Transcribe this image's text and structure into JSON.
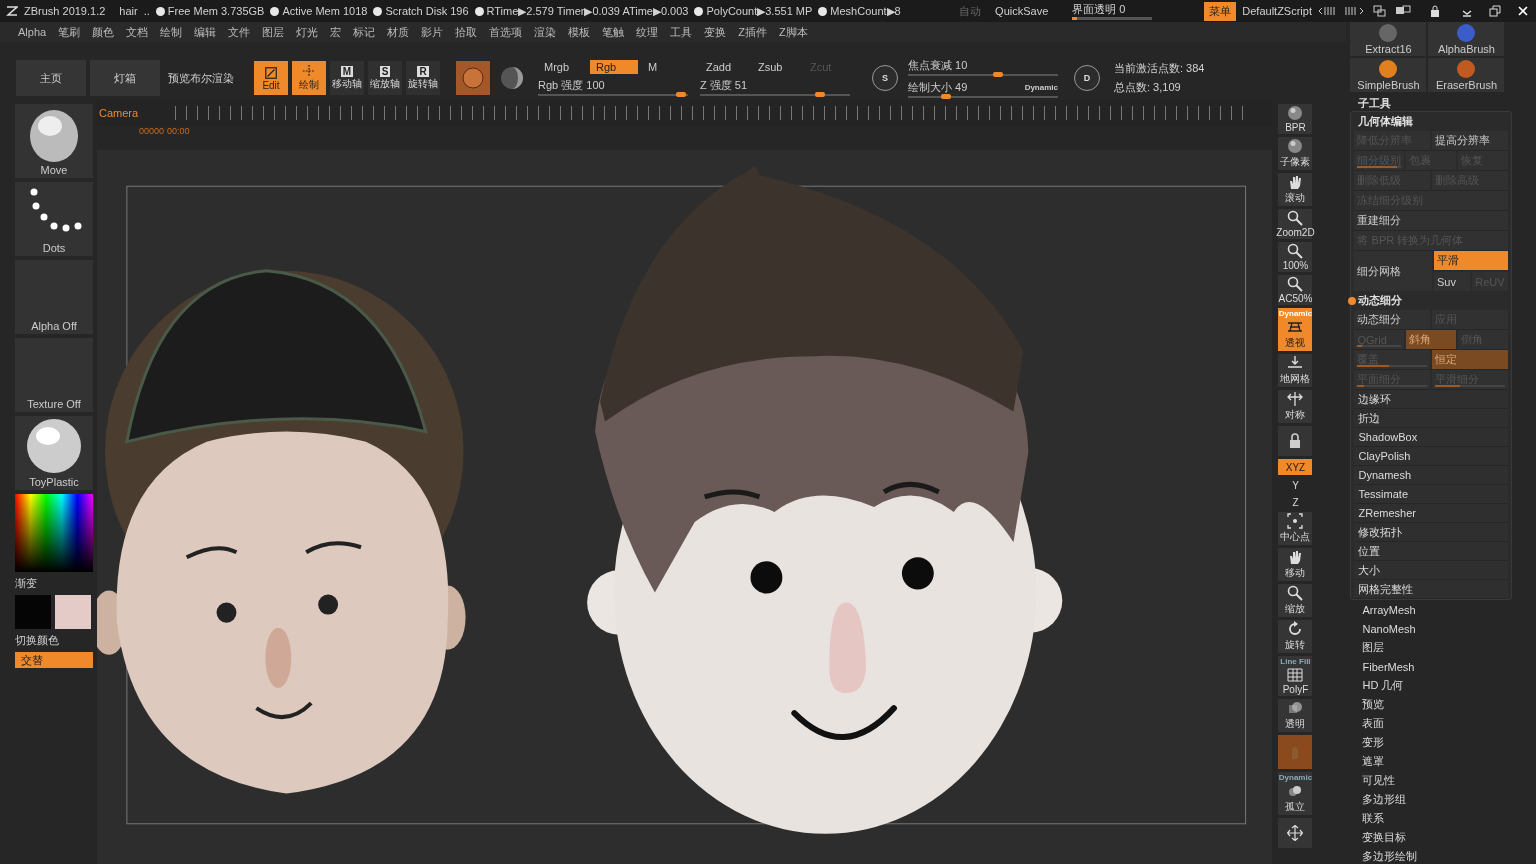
{
  "title_bar": {
    "app": "ZBrush 2019.1.2",
    "document": "hair",
    "more": "..",
    "stats": [
      "Free Mem 3.735GB",
      "Active Mem 1018",
      "Scratch Disk 196",
      "RTime▶2.579 Timer▶0.039 ATime▶0.003",
      "PolyCount▶3.551 MP",
      "MeshCount▶8"
    ],
    "auto": {
      "label": "自动",
      "disabled": true
    },
    "quicksave": "QuickSave",
    "transparency": {
      "label": "界面透明 0",
      "level": 0.06
    },
    "menu_button": "菜单",
    "script": "DefaultZScript"
  },
  "menus": [
    "Alpha",
    "笔刷",
    "颜色",
    "文档",
    "绘制",
    "编辑",
    "文件",
    "图层",
    "灯光",
    "宏",
    "标记",
    "材质",
    "影片",
    "拾取",
    "首选项",
    "渲染",
    "模板",
    "笔触",
    "纹理",
    "工具",
    "变换",
    "Z插件",
    "Z脚本"
  ],
  "toolbar": {
    "buttons": [
      "主页",
      "灯箱"
    ],
    "preview": "预览布尔渲染",
    "modes": [
      {
        "kind": "edit",
        "label": "Edit",
        "selected": true
      },
      {
        "kind": "draw",
        "label": "绘制",
        "selected": true
      },
      {
        "kind": "axis",
        "key": "M",
        "label": "移动轴",
        "selected": false
      },
      {
        "kind": "axis",
        "key": "S",
        "label": "缩放轴",
        "selected": false
      },
      {
        "kind": "axis",
        "key": "R",
        "label": "旋转轴",
        "selected": false
      }
    ],
    "channels": [
      {
        "label": "Mrgb",
        "selected": false
      },
      {
        "label": "Rgb",
        "selected": true
      },
      {
        "label": "M",
        "selected": false
      }
    ],
    "rgb_intensity": {
      "label": "Rgb 强度 100",
      "level": 0.95
    },
    "depth_modes": [
      {
        "label": "Zadd",
        "disabled": false
      },
      {
        "label": "Zsub",
        "disabled": false
      },
      {
        "label": "Zcut",
        "disabled": true
      }
    ],
    "z_intensity": {
      "label": "Z 强度 51",
      "level": 0.8
    },
    "s_key": "S",
    "focal_shift": {
      "label": "焦点衰减 10",
      "level": 0.6
    },
    "draw_size": {
      "label": "绘制大小 49",
      "level": 0.25
    },
    "dynamic": "Dynamic",
    "d_key": "D",
    "active_points": "当前激活点数: 384",
    "total_points": "总点数: 3,109"
  },
  "shelf": {
    "thumbs": [
      {
        "kind": "brush",
        "label": "Move"
      },
      {
        "kind": "stroke",
        "label": "Dots"
      },
      {
        "kind": "empty",
        "label": "Alpha Off"
      },
      {
        "kind": "empty",
        "label": "Texture Off"
      },
      {
        "kind": "material",
        "label": "ToyPlastic"
      }
    ],
    "gradient": "渐变",
    "swatches": [
      {
        "color": "#050505"
      },
      {
        "color": "#e4cbc8"
      }
    ],
    "switch_color": "切换颜色",
    "alternate": "交替"
  },
  "timeline": {
    "label": "Camera",
    "frame": "00000",
    "time": "00:00"
  },
  "right_shelf": [
    {
      "kind": "sphere",
      "label": "BPR"
    },
    {
      "kind": "subpixel",
      "label": "子像素"
    },
    {
      "kind": "hand",
      "label": "滚动"
    },
    {
      "kind": "zoom",
      "label": "Zoom2D"
    },
    {
      "kind": "zoom",
      "label": "100%"
    },
    {
      "kind": "zoom",
      "label": "AC50%"
    },
    {
      "kind": "perspective",
      "top": "Dynamic",
      "label": "透视",
      "selected": true
    },
    {
      "kind": "floor",
      "label": "地网格"
    },
    {
      "kind": "symmetry",
      "label": "对称"
    },
    {
      "kind": "lock"
    },
    {
      "kind": "xyz",
      "label": "XYZ",
      "selected": true
    },
    {
      "kind": "small",
      "label": "Y"
    },
    {
      "kind": "small",
      "label": "Z"
    },
    {
      "kind": "center",
      "label": "中心点"
    },
    {
      "kind": "hand",
      "label": "移动"
    },
    {
      "kind": "zoom",
      "label": "缩放"
    },
    {
      "kind": "rotate",
      "label": "旋转"
    },
    {
      "kind": "polyframe",
      "top": "Line Fill",
      "label": "PolyF"
    },
    {
      "kind": "transp",
      "label": "透明"
    },
    {
      "kind": "ghost"
    },
    {
      "kind": "solo",
      "top": "Dynamic",
      "label": "孤立"
    },
    {
      "kind": "expand"
    }
  ],
  "right_panel": {
    "brushes": [
      {
        "kind": "extract",
        "label": "Extract16"
      },
      {
        "kind": "alpha",
        "label": "AlphaBrush"
      },
      {
        "kind": "simple",
        "label": "SimpleBrush"
      },
      {
        "kind": "eraser",
        "label": "EraserBrush"
      }
    ],
    "subtool": "子工具",
    "geometry": {
      "title": "几何体编辑",
      "rows": [
        [
          {
            "label": "降低分辨率",
            "disabled": true
          },
          {
            "label": "提高分辨率",
            "disabled": false
          }
        ],
        [
          {
            "label": "细分级别",
            "disabled": true,
            "level": 0.9
          },
          {
            "label": "包裹",
            "disabled": true
          },
          {
            "label": "恢复",
            "disabled": true
          }
        ],
        [
          {
            "label": "删除低级",
            "disabled": true
          },
          {
            "label": "删除高级",
            "disabled": true
          }
        ],
        [
          {
            "label": "冻结细分级别",
            "disabled": true
          }
        ],
        [
          {
            "label": "重建细分",
            "disabled": false
          }
        ],
        [
          {
            "label": "将 BPR 转换为几何体",
            "disabled": true
          }
        ]
      ],
      "divide": {
        "label": "细分网格",
        "smooth": {
          "label": "平滑",
          "selected": true
        },
        "options": [
          {
            "label": "Suv",
            "selected": false,
            "disabled": false
          },
          {
            "label": "ReUV",
            "selected": false,
            "disabled": true
          }
        ]
      },
      "dynamic_title": "动态细分",
      "dynamic_rows": [
        [
          {
            "label": "动态细分",
            "disabled": false
          },
          {
            "label": "应用",
            "disabled": true
          }
        ],
        [
          {
            "label": "QGrid",
            "disabled": true,
            "level": 0.1
          },
          {
            "label": "斜角",
            "disabled": true,
            "selected": true
          },
          {
            "label": "倒角",
            "disabled": true,
            "selected": false
          }
        ],
        [
          {
            "label": "覆盖",
            "disabled": true,
            "level": 0.45
          },
          {
            "label": "恒定",
            "disabled": true,
            "selected": true
          }
        ],
        [
          {
            "label": "平面细分",
            "disabled": true,
            "level": 0.1
          },
          {
            "label": "平滑细分",
            "disabled": true,
            "level": 0.35
          }
        ]
      ],
      "items": [
        "边缘环",
        "折边",
        "ShadowBox",
        "ClayPolish",
        "Dynamesh",
        "Tessimate",
        "ZRemesher",
        "修改拓扑",
        "位置",
        "大小",
        "网格完整性"
      ]
    },
    "items": [
      "ArrayMesh",
      "NanoMesh",
      "图层",
      "FiberMesh",
      "HD 几何",
      "预览",
      "表面",
      "变形",
      "遮罩",
      "可见性",
      "多边形组",
      "联系",
      "变换目标",
      "多边形绘制"
    ]
  }
}
